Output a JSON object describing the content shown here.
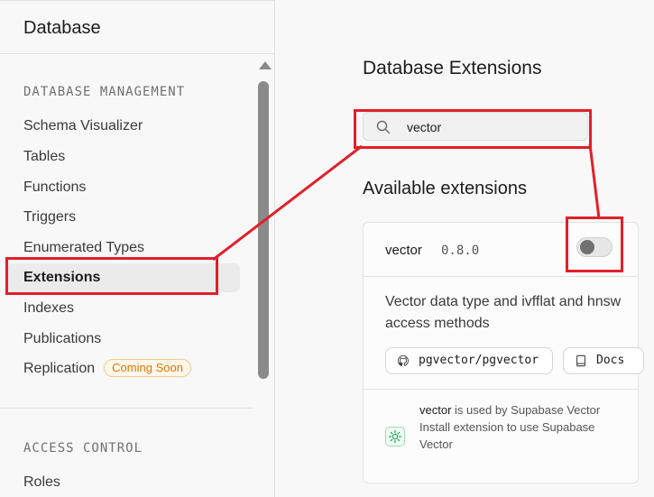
{
  "sidebar": {
    "title": "Database",
    "sections": [
      {
        "title": "DATABASE MANAGEMENT",
        "items": [
          {
            "label": "Schema Visualizer"
          },
          {
            "label": "Tables"
          },
          {
            "label": "Functions"
          },
          {
            "label": "Triggers"
          },
          {
            "label": "Enumerated Types"
          },
          {
            "label": "Extensions",
            "active": true
          },
          {
            "label": "Indexes"
          },
          {
            "label": "Publications"
          },
          {
            "label": "Replication",
            "badge": "Coming Soon"
          }
        ]
      },
      {
        "title": "ACCESS CONTROL",
        "items": [
          {
            "label": "Roles"
          }
        ]
      }
    ]
  },
  "main": {
    "title": "Database Extensions",
    "search": {
      "value": "vector",
      "icon": "search-icon"
    },
    "available_title": "Available extensions",
    "extension": {
      "name": "vector",
      "version": "0.8.0",
      "enabled": false,
      "description": "Vector data type and ivfflat and hnsw access methods",
      "links": [
        {
          "label": "pgvector/pgvector",
          "icon": "github-icon"
        },
        {
          "label": "Docs",
          "icon": "book-icon"
        }
      ],
      "usage": {
        "name": "vector",
        "used_by_text": " is used by Supabase Vector",
        "install_text": "Install extension to use Supabase Vector"
      }
    }
  },
  "colors": {
    "annotation": "#e0202a",
    "badge": "#d97706",
    "toggle_knob": "#707070"
  }
}
